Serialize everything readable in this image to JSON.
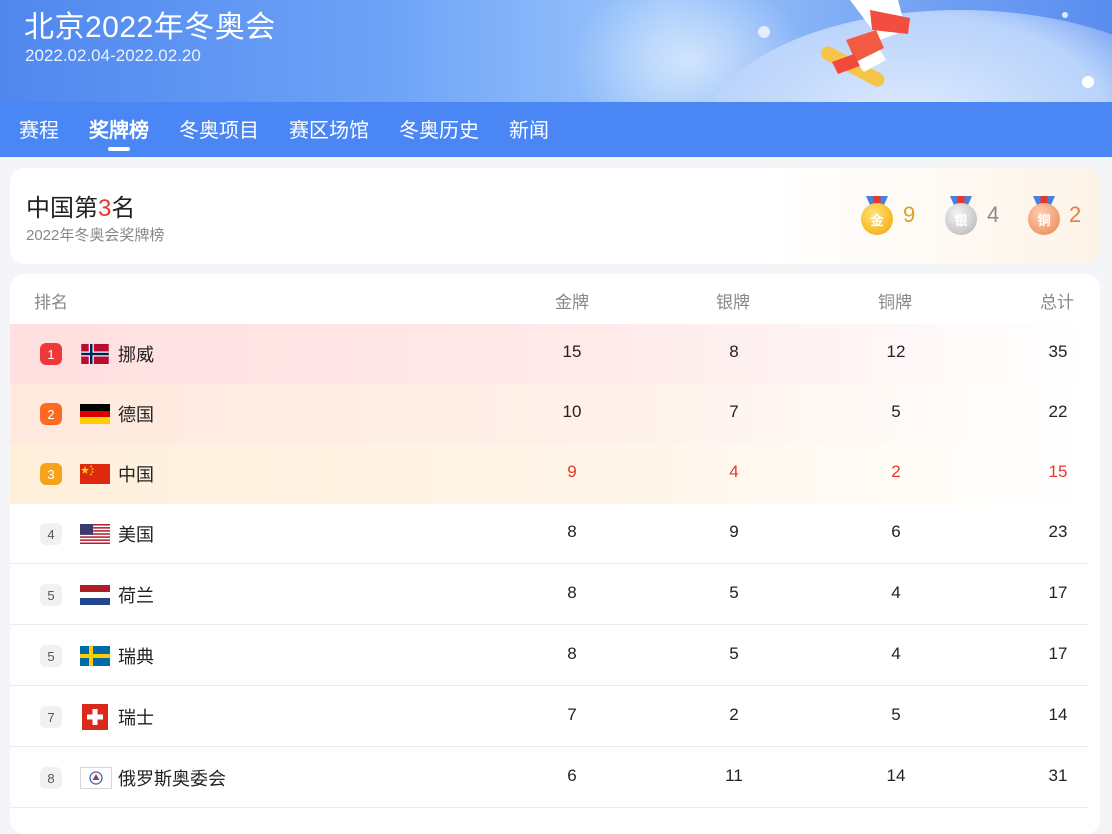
{
  "header": {
    "title": "北京2022年冬奥会",
    "dates": "2022.02.04-2022.02.20"
  },
  "nav": {
    "tabs": [
      {
        "label": "赛程",
        "active": false
      },
      {
        "label": "奖牌榜",
        "active": true
      },
      {
        "label": "冬奥项目",
        "active": false
      },
      {
        "label": "赛区场馆",
        "active": false
      },
      {
        "label": "冬奥历史",
        "active": false
      },
      {
        "label": "新闻",
        "active": false
      }
    ]
  },
  "summary": {
    "rank_prefix": "中国第",
    "rank_number": "3",
    "rank_suffix": "名",
    "subtitle": "2022年冬奥会奖牌榜",
    "medals": {
      "gold": {
        "icon_label": "金",
        "count": "9",
        "color": "#d9a21f"
      },
      "silver": {
        "icon_label": "银",
        "count": "4",
        "color": "#8a8a8a"
      },
      "bronze": {
        "icon_label": "铜",
        "count": "2",
        "color": "#ee7a3a"
      }
    }
  },
  "table": {
    "headers": {
      "rank": "排名",
      "gold": "金牌",
      "silver": "银牌",
      "bronze": "铜牌",
      "total": "总计"
    },
    "rows": [
      {
        "rank": "1",
        "country": "挪威",
        "flag": "norway-flag",
        "gold": "15",
        "silver": "8",
        "bronze": "12",
        "total": "35"
      },
      {
        "rank": "2",
        "country": "德国",
        "flag": "germany-flag",
        "gold": "10",
        "silver": "7",
        "bronze": "5",
        "total": "22"
      },
      {
        "rank": "3",
        "country": "中国",
        "flag": "china-flag",
        "gold": "9",
        "silver": "4",
        "bronze": "2",
        "total": "15"
      },
      {
        "rank": "4",
        "country": "美国",
        "flag": "usa-flag",
        "gold": "8",
        "silver": "9",
        "bronze": "6",
        "total": "23"
      },
      {
        "rank": "5",
        "country": "荷兰",
        "flag": "netherlands-flag",
        "gold": "8",
        "silver": "5",
        "bronze": "4",
        "total": "17"
      },
      {
        "rank": "5",
        "country": "瑞典",
        "flag": "sweden-flag",
        "gold": "8",
        "silver": "5",
        "bronze": "4",
        "total": "17"
      },
      {
        "rank": "7",
        "country": "瑞士",
        "flag": "switzerland-flag",
        "gold": "7",
        "silver": "2",
        "bronze": "5",
        "total": "14"
      },
      {
        "rank": "8",
        "country": "俄罗斯奥委会",
        "flag": "roc-flag",
        "gold": "6",
        "silver": "11",
        "bronze": "14",
        "total": "31"
      }
    ],
    "highlight_row_country": "中国",
    "highlight_color": "#e8372b"
  }
}
